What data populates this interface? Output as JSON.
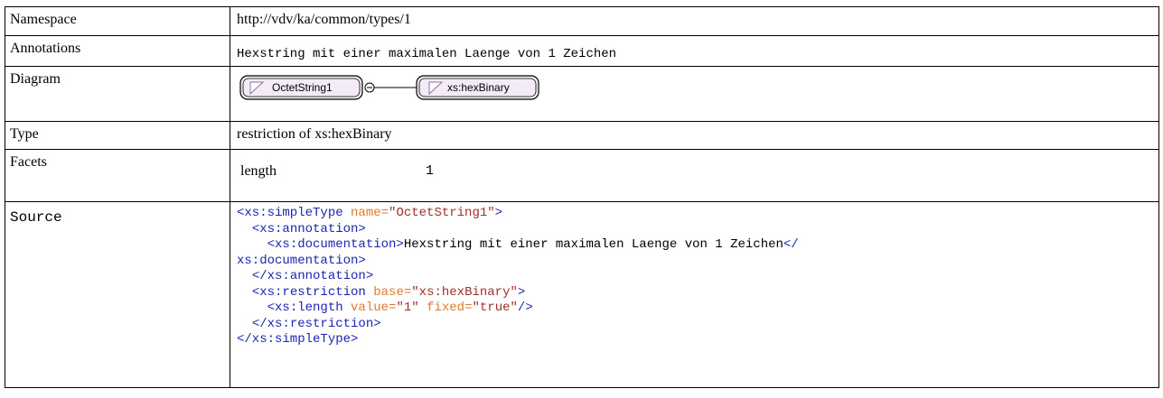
{
  "rows": {
    "namespace": {
      "label": "Namespace",
      "value": "http://vdv/ka/common/types/1"
    },
    "annotations": {
      "label": "Annotations",
      "value": "Hexstring mit einer maximalen Laenge von 1 Zeichen"
    },
    "diagram": {
      "label": "Diagram",
      "node_left": "OctetString1",
      "node_right": "xs:hexBinary"
    },
    "type": {
      "label": "Type",
      "value": "restriction of xs:hexBinary"
    },
    "facets": {
      "label": "Facets",
      "name": "length",
      "value": "1"
    },
    "source": {
      "label": "Source"
    }
  },
  "source_lines": [
    {
      "indent": "",
      "parts": [
        {
          "t": "tag",
          "v": "<xs:simpleType"
        },
        {
          "t": "txt",
          "v": " "
        },
        {
          "t": "attr",
          "v": "name="
        },
        {
          "t": "aval",
          "v": "\"OctetString1\""
        },
        {
          "t": "tag",
          "v": ">"
        }
      ]
    },
    {
      "indent": "  ",
      "parts": [
        {
          "t": "tag",
          "v": "<xs:annotation>"
        }
      ]
    },
    {
      "indent": "    ",
      "parts": [
        {
          "t": "tag",
          "v": "<xs:documentation>"
        },
        {
          "t": "txt",
          "v": "Hexstring mit einer maximalen Laenge von 1 Zeichen"
        },
        {
          "t": "tag",
          "v": "</"
        }
      ]
    },
    {
      "indent": "",
      "parts": [
        {
          "t": "tag",
          "v": "xs:documentation>"
        }
      ]
    },
    {
      "indent": "  ",
      "parts": [
        {
          "t": "tag",
          "v": "</xs:annotation>"
        }
      ]
    },
    {
      "indent": "  ",
      "parts": [
        {
          "t": "tag",
          "v": "<xs:restriction"
        },
        {
          "t": "txt",
          "v": " "
        },
        {
          "t": "attr",
          "v": "base="
        },
        {
          "t": "aval",
          "v": "\"xs:hexBinary\""
        },
        {
          "t": "tag",
          "v": ">"
        }
      ]
    },
    {
      "indent": "    ",
      "parts": [
        {
          "t": "tag",
          "v": "<xs:length"
        },
        {
          "t": "txt",
          "v": " "
        },
        {
          "t": "attr",
          "v": "value="
        },
        {
          "t": "aval",
          "v": "\"1\""
        },
        {
          "t": "txt",
          "v": " "
        },
        {
          "t": "attr",
          "v": "fixed="
        },
        {
          "t": "aval",
          "v": "\"true\""
        },
        {
          "t": "tag",
          "v": "/>"
        }
      ]
    },
    {
      "indent": "  ",
      "parts": [
        {
          "t": "tag",
          "v": "</xs:restriction>"
        }
      ]
    },
    {
      "indent": "",
      "parts": [
        {
          "t": "tag",
          "v": "</xs:simpleType>"
        }
      ]
    }
  ],
  "colors": {
    "tag": "#1a24b4",
    "attr": "#e07a2a",
    "attr_value": "#a0302a",
    "node_fill": "#f3ecf7",
    "node_border": "#000000"
  }
}
